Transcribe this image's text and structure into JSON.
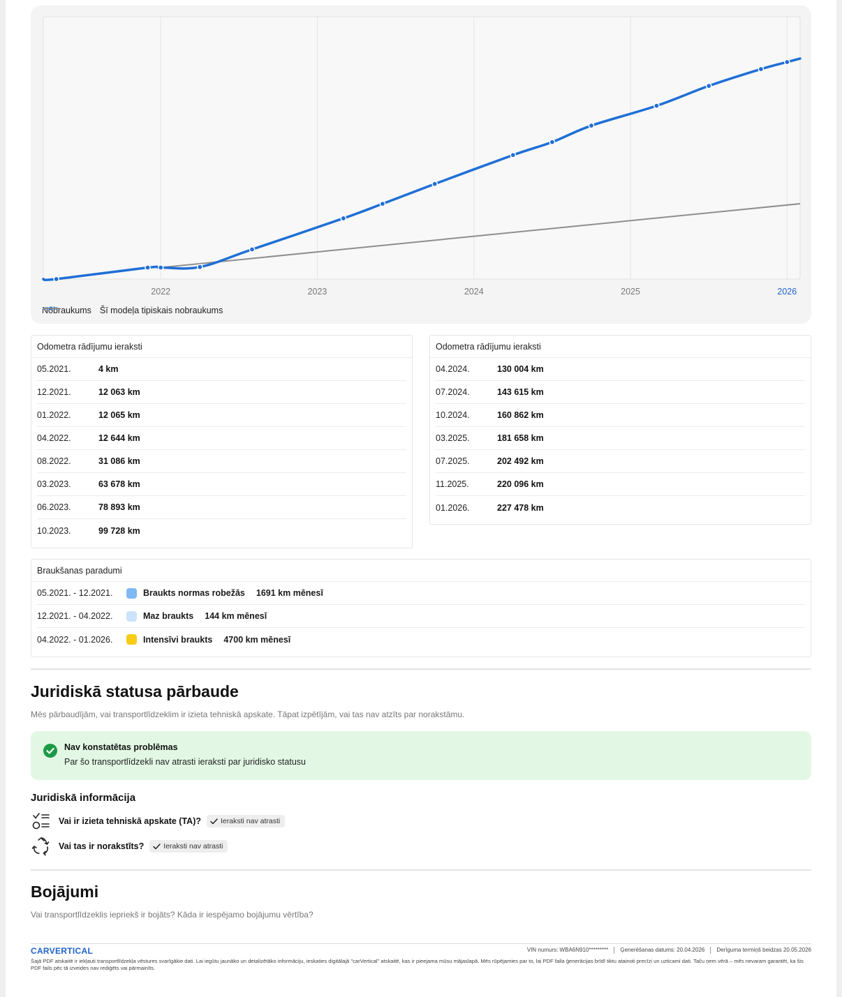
{
  "chart_data": {
    "type": "line",
    "x_ticks": [
      "2022",
      "2023",
      "2024",
      "2025",
      "2026"
    ],
    "highlighted_tick": "2026",
    "series": [
      {
        "name": "Nobraukums",
        "color": "#1f6fd6",
        "points": [
          {
            "date": "2021-05",
            "km": 4
          },
          {
            "date": "2021-12",
            "km": 12063
          },
          {
            "date": "2022-01",
            "km": 12065
          },
          {
            "date": "2022-04",
            "km": 12644
          },
          {
            "date": "2022-08",
            "km": 31086
          },
          {
            "date": "2023-03",
            "km": 63678
          },
          {
            "date": "2023-06",
            "km": 78893
          },
          {
            "date": "2023-10",
            "km": 99728
          },
          {
            "date": "2024-04",
            "km": 130004
          },
          {
            "date": "2024-07",
            "km": 143615
          },
          {
            "date": "2024-10",
            "km": 160862
          },
          {
            "date": "2025-03",
            "km": 181658
          },
          {
            "date": "2025-07",
            "km": 202492
          },
          {
            "date": "2025-11",
            "km": 220096
          },
          {
            "date": "2026-01",
            "km": 227478
          }
        ]
      },
      {
        "name": "Šī modeļa tipiskais nobraukums",
        "color": "#8e8e8e",
        "points": [
          {
            "date": "2022-01",
            "km": 12065
          },
          {
            "date": "2026-02",
            "km": 79000
          }
        ]
      }
    ],
    "grid": true,
    "legend": "bottom-left"
  },
  "odometer_left": {
    "title": "Odometra rādījumu ieraksti",
    "rows": [
      {
        "date": "05.2021.",
        "value": "4 km"
      },
      {
        "date": "12.2021.",
        "value": "12 063 km"
      },
      {
        "date": "01.2022.",
        "value": "12 065 km"
      },
      {
        "date": "04.2022.",
        "value": "12 644 km"
      },
      {
        "date": "08.2022.",
        "value": "31 086 km"
      },
      {
        "date": "03.2023.",
        "value": "63 678 km"
      },
      {
        "date": "06.2023.",
        "value": "78 893 km"
      },
      {
        "date": "10.2023.",
        "value": "99 728 km"
      }
    ]
  },
  "odometer_right": {
    "title": "Odometra rādījumu ieraksti",
    "rows": [
      {
        "date": "04.2024.",
        "value": "130 004 km"
      },
      {
        "date": "07.2024.",
        "value": "143 615 km"
      },
      {
        "date": "10.2024.",
        "value": "160 862 km"
      },
      {
        "date": "03.2025.",
        "value": "181 658 km"
      },
      {
        "date": "07.2025.",
        "value": "202 492 km"
      },
      {
        "date": "11.2025.",
        "value": "220 096 km"
      },
      {
        "date": "01.2026.",
        "value": "227 478 km"
      }
    ]
  },
  "habits": {
    "title": "Braukšanas paradumi",
    "rows": [
      {
        "period": "05.2021. - 12.2021.",
        "type": "Braukts normas robežās",
        "rate": "1691 km mēnesī",
        "color": "#7fb9f3"
      },
      {
        "period": "12.2021. - 04.2022.",
        "type": "Maz braukts",
        "rate": "144 km mēnesī",
        "color": "#cbe4fb"
      },
      {
        "period": "04.2022. - 01.2026.",
        "type": "Intensīvi braukts",
        "rate": "4700 km mēnesī",
        "color": "#f6cc16"
      }
    ]
  },
  "legal": {
    "title": "Juridiskā statusa pārbaude",
    "subtitle": "Mēs pārbaudījām, vai transportlīdzeklim ir izieta tehniskā apskate. Tāpat izpētījām, vai tas nav atzīts par norakstāmu.",
    "status_title": "Nav konstatētas problēmas",
    "status_desc": "Par šo transportlīdzekli nav atrasti ieraksti par juridisko statusu",
    "info_title": "Juridiskā informācija",
    "q1": "Vai ir izieta tehniskā apskate (TA)?",
    "q1_badge": "Ieraksti nav atrasti",
    "q2": "Vai tas ir norakstīts?",
    "q2_badge": "Ieraksti nav atrasti"
  },
  "damage": {
    "title": "Bojājumi",
    "subtitle": "Vai transportlīdzeklis iepriekš ir bojāts? Kāda ir iespējamo bojājumu vērtība?"
  },
  "footer": {
    "brand": "CARVERTICAL",
    "vin": "VIN numurs:  WBA6N910*********",
    "generated": "Ģenerēšanas datums:  20.04.2026",
    "valid": "Derīguma termiņš beidzas  20.05.2026",
    "disclaimer": "Šajā PDF atskaitē ir iekļauti transportlīdzekļa vēstures svarīgākie dati. Lai iegūtu jaunāko un detalizētāko informāciju, ieskaties digitālajā \"carVertical\" atskaitē, kas ir pieejama mūsu mājaslapā. Mēs rūpējamies par to, lai PDF faila ģenerācijas brīdī tiktu atainoti precīzi un uzticami dati. Taču ņem vērā – mēs nevaram garantēt, ka šis PDF fails pēc tā izveides nav rediģēts vai pārmainīts."
  },
  "colors": {
    "accent": "#1e63c9",
    "success": "#1c9a48",
    "success_bg": "#e2f8e4"
  }
}
